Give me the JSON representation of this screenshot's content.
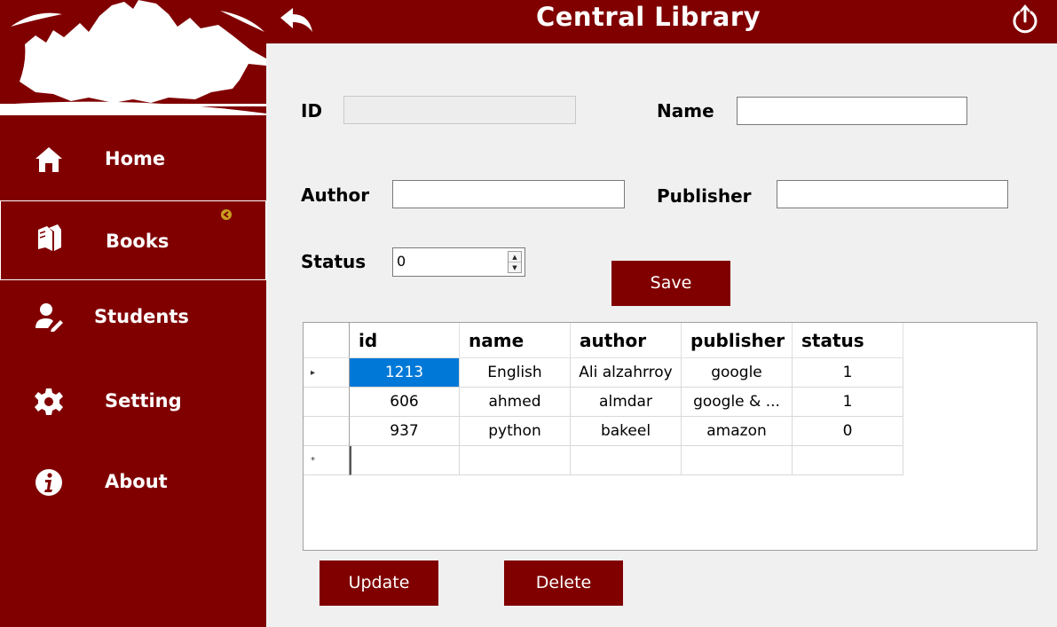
{
  "header": {
    "title": "Central Library"
  },
  "sidebar": {
    "items": [
      {
        "label": "Home",
        "icon": "home-icon"
      },
      {
        "label": "Books",
        "icon": "books-icon"
      },
      {
        "label": "Students",
        "icon": "student-icon"
      },
      {
        "label": "Setting",
        "icon": "gear-icon"
      },
      {
        "label": "About",
        "icon": "info-icon"
      }
    ],
    "active": "Books"
  },
  "form": {
    "id_label": "ID",
    "id_value": "",
    "name_label": "Name",
    "name_value": "",
    "author_label": "Author",
    "author_value": "",
    "publisher_label": "Publisher",
    "publisher_value": "",
    "status_label": "Status",
    "status_value": "0",
    "save_label": "Save"
  },
  "table": {
    "columns": [
      "id",
      "name",
      "author",
      "publisher",
      "status"
    ],
    "rows": [
      [
        "1213",
        "English",
        "Ali alzahrroy",
        "google",
        "1"
      ],
      [
        "606",
        "ahmed",
        "almdar",
        "google & ...",
        "1"
      ],
      [
        "937",
        "python",
        "bakeel",
        "amazon",
        "0"
      ]
    ],
    "new_row_marker": "*",
    "current_row_marker": "▸"
  },
  "actions": {
    "update_label": "Update",
    "delete_label": "Delete"
  },
  "colors": {
    "brand": "#800000",
    "selection": "#0078d7",
    "background": "#f0f0f0"
  }
}
